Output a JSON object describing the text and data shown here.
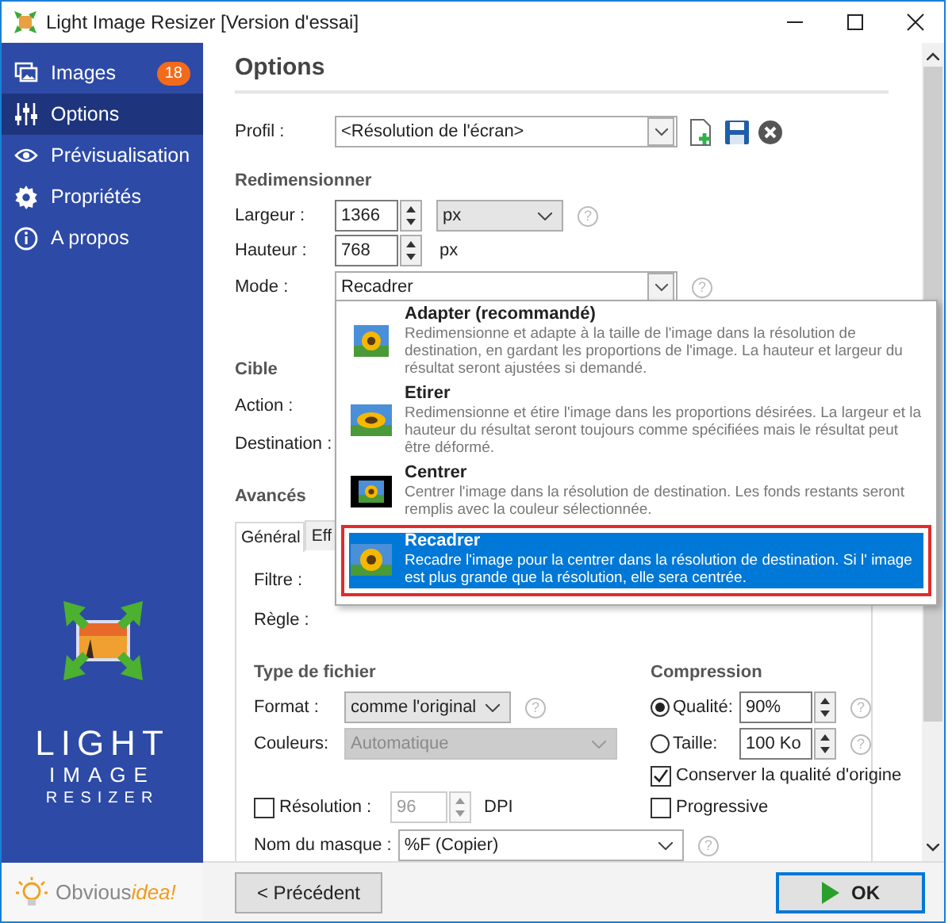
{
  "window": {
    "title": "Light Image Resizer  [Version d'essai]"
  },
  "sidebar": {
    "items": [
      {
        "label": "Images",
        "badge": "18",
        "selected": false
      },
      {
        "label": "Options",
        "selected": true
      },
      {
        "label": "Prévisualisation",
        "selected": false
      },
      {
        "label": "Propriétés",
        "selected": false
      },
      {
        "label": "A propos",
        "selected": false
      }
    ],
    "logo_lines": [
      "LIGHT",
      "IMAGE",
      "RESIZER"
    ],
    "footer": {
      "brand": "Obvious",
      "accent": "idea!"
    }
  },
  "page": {
    "title": "Options"
  },
  "profile": {
    "label": "Profil :",
    "value": "<Résolution de l'écran>"
  },
  "resize": {
    "heading": "Redimensionner",
    "width": {
      "label": "Largeur :",
      "value": "1366",
      "unit": "px",
      "help": "?"
    },
    "height": {
      "label": "Hauteur :",
      "value": "768",
      "unit": "px"
    },
    "mode": {
      "label": "Mode :",
      "value": "Recadrer",
      "help": "?"
    }
  },
  "mode_menu": {
    "options": [
      {
        "kind": "fit",
        "title": "Adapter (recommandé)",
        "description": "Redimensionne et adapte à la taille de l'image dans la résolution de destination, en gardant les proportions de l'image. La hauteur et largeur du résultat seront ajustées si demandé.",
        "selected": false
      },
      {
        "kind": "stretch",
        "title": "Etirer",
        "description": "Redimensionne et étire l'image dans les proportions désirées. La largeur et la hauteur du résultat seront toujours comme spécifiées mais le résultat peut être déformé.",
        "selected": false
      },
      {
        "kind": "center",
        "title": "Centrer",
        "description": "Centrer l'image dans la résolution de destination. Les fonds restants seront remplis avec la couleur sélectionnée.",
        "selected": false
      },
      {
        "kind": "crop",
        "title": "Recadrer",
        "description": "Recadre l'image pour la centrer dans la résolution de destination. Si l' image est plus grande que la résolution, elle sera centrée.",
        "selected": true
      }
    ]
  },
  "target": {
    "heading": "Cible",
    "action_label": "Action :",
    "destination_label": "Destination :"
  },
  "advanced": {
    "heading": "Avancés",
    "tabs": [
      {
        "label": "Général",
        "selected": true
      },
      {
        "label": "Eff",
        "selected": false
      }
    ],
    "filter_label": "Filtre :",
    "rule_label": "Règle :"
  },
  "file_type": {
    "heading": "Type de fichier",
    "format": {
      "label": "Format :",
      "value": "comme l'original",
      "help": "?",
      "disabled": false
    },
    "colors": {
      "label": "Couleurs:",
      "value": "Automatique",
      "disabled": true
    },
    "resolution": {
      "label": "Résolution :",
      "checked": false,
      "value": "96",
      "unit": "DPI",
      "disabled": true
    },
    "mask": {
      "label": "Nom du masque :",
      "value": "%F (Copier)",
      "help": "?"
    }
  },
  "compression": {
    "heading": "Compression",
    "quality": {
      "label": "Qualité:",
      "selected": true,
      "value": "90%",
      "help": "?"
    },
    "size": {
      "label": "Taille:",
      "selected": false,
      "value": "100 Ko",
      "help": "?"
    },
    "keep_quality": {
      "label": "Conserver la qualité d'origine",
      "checked": true
    },
    "progressive": {
      "label": "Progressive",
      "checked": false
    }
  },
  "buttons": {
    "previous": "< Précédent",
    "ok": "OK"
  }
}
